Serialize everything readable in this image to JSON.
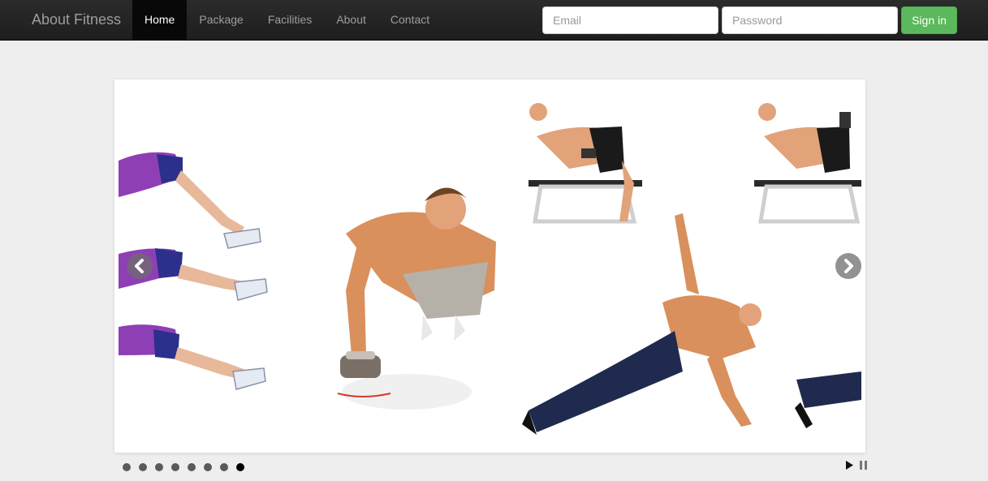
{
  "navbar": {
    "brand": "About Fitness",
    "items": [
      {
        "label": "Home",
        "active": true
      },
      {
        "label": "Package",
        "active": false
      },
      {
        "label": "Facilities",
        "active": false
      },
      {
        "label": "About",
        "active": false
      },
      {
        "label": "Contact",
        "active": false
      }
    ],
    "email_placeholder": "Email",
    "password_placeholder": "Password",
    "signin_label": "Sign in"
  },
  "carousel": {
    "slide_count": 8,
    "active_index": 7,
    "icons": {
      "prev": "chevron-left-icon",
      "next": "chevron-right-icon",
      "play": "play-icon",
      "pause": "pause-icon"
    }
  },
  "colors": {
    "navbar_bg": "#222222",
    "signin": "#5cb85c",
    "page_bg": "#eeeeee"
  }
}
